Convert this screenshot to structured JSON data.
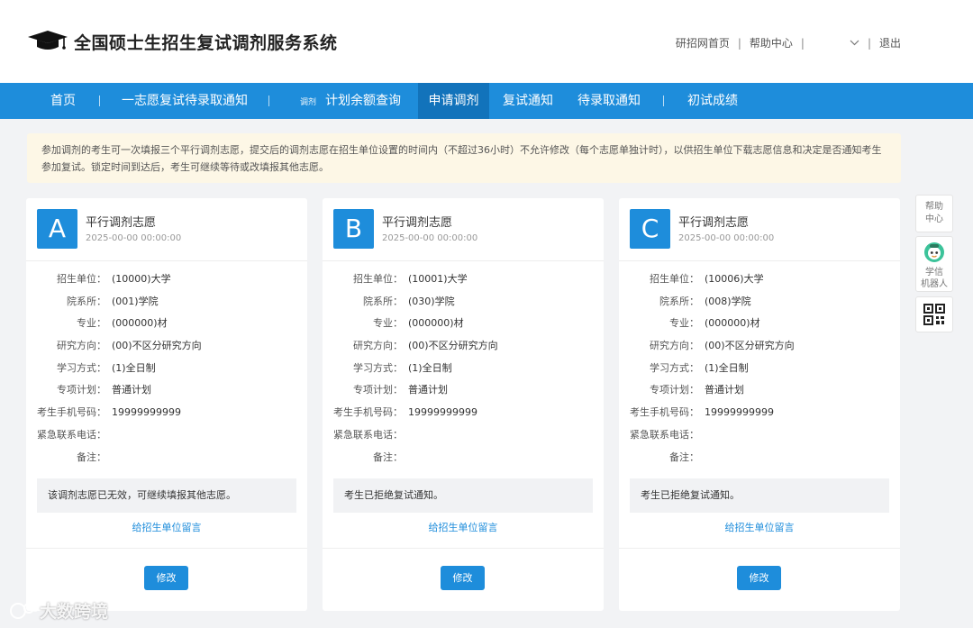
{
  "header": {
    "site_title": "全国硕士生招生复试调剂服务系统",
    "links": {
      "home": "研招网首页",
      "help": "帮助中心",
      "separator": "|",
      "logout": "退出"
    },
    "dropdown_icon": "chevron-down-icon"
  },
  "nav": {
    "items": [
      {
        "label": "首页"
      },
      {
        "label": "一志愿复试待录取通知"
      },
      {
        "prefix": "调剂",
        "label": "计划余额查询"
      },
      {
        "label": "申请调剂",
        "active": true
      },
      {
        "label": "复试通知"
      },
      {
        "label": "待录取通知"
      },
      {
        "label": "初试成绩"
      }
    ]
  },
  "notice": {
    "text": "参加调剂的考生可一次填报三个平行调剂志愿，提交后的调剂志愿在招生单位设置的时间内（不超过36小时）不允许修改（每个志愿单独计时），以供招生单位下载志愿信息和决定是否通知考生参加复试。锁定时间到达后，考生可继续等待或改填报其他志愿。"
  },
  "field_labels": {
    "unit": "招生单位：",
    "dept": "院系所：",
    "major": "专业：",
    "direction": "研究方向：",
    "mode": "学习方式：",
    "plan": "专项计划：",
    "phone": "考生手机号码：",
    "emergency": "紧急联系电话：",
    "remark": "备注："
  },
  "cards": [
    {
      "letter": "A",
      "title": "平行调剂志愿",
      "date": "2025-00-00 00:00:00",
      "unit": "(10000)大学",
      "dept": "(001)学院",
      "major": "(000000)材",
      "direction": "(00)不区分研究方向",
      "mode": "(1)全日制",
      "plan": "普通计划",
      "phone": "19999999999",
      "emergency": "",
      "remark": "",
      "status": "该调剂志愿已无效，可继续填报其他志愿。",
      "message_link": "给招生单位留言",
      "edit_label": "修改"
    },
    {
      "letter": "B",
      "title": "平行调剂志愿",
      "date": "2025-00-00 00:00:00",
      "unit": "(10001)大学",
      "dept": "(030)学院",
      "major": "(000000)材",
      "direction": "(00)不区分研究方向",
      "mode": "(1)全日制",
      "plan": "普通计划",
      "phone": "19999999999",
      "emergency": "",
      "remark": "",
      "status": "考生已拒绝复试通知。",
      "message_link": "给招生单位留言",
      "edit_label": "修改"
    },
    {
      "letter": "C",
      "title": "平行调剂志愿",
      "date": "2025-00-00 00:00:00",
      "unit": "(10006)大学",
      "dept": "(008)学院",
      "major": "(000000)材",
      "direction": "(00)不区分研究方向",
      "mode": "(1)全日制",
      "plan": "普通计划",
      "phone": "19999999999",
      "emergency": "",
      "remark": "",
      "status": "考生已拒绝复试通知。",
      "message_link": "给招生单位留言",
      "edit_label": "修改"
    }
  ],
  "sidebar": {
    "help_line1": "帮助",
    "help_line2": "中心",
    "bot_line1": "学信",
    "bot_line2": "机器人",
    "qr_icon": "qr-code-icon"
  },
  "watermark": {
    "text": "大数跨境"
  },
  "colors": {
    "primary": "#1e8ddb",
    "nav_active": "#1273bb",
    "notice_bg": "#fdf7e6"
  }
}
